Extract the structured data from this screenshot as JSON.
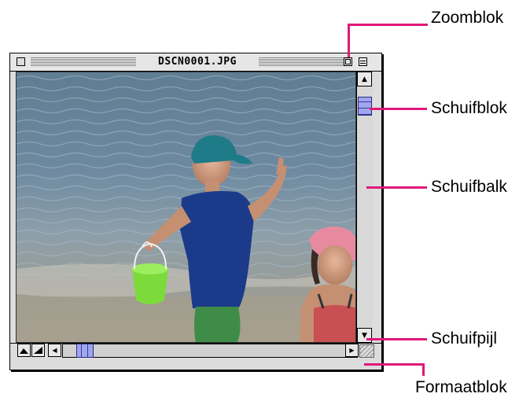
{
  "window": {
    "title": "DSCN0001.JPG",
    "accent_color": "#9fa6ee",
    "thumb_border_color": "#2a2a80"
  },
  "buttons": {
    "close_icon": "close-box-icon",
    "zoom_icon": "zoom-box-icon",
    "collapse_icon": "windowshade-box-icon",
    "scroll_up_icon": "triangle-up",
    "scroll_down_icon": "triangle-down",
    "scroll_left_icon": "triangle-left",
    "scroll_right_icon": "triangle-right",
    "view_mode_1_icon": "mountain-icon",
    "view_mode_2_icon": "half-triangle-icon",
    "grow_box_icon": "diagonal-lines-icon"
  },
  "callouts": {
    "color": "#e0187a",
    "zoom_box": "Zoomblok",
    "scroll_thumb": "Schuifblok",
    "scroll_bar": "Schuifbalk",
    "scroll_arrow": "Schuifpijl",
    "size_box": "Formaatblok"
  }
}
